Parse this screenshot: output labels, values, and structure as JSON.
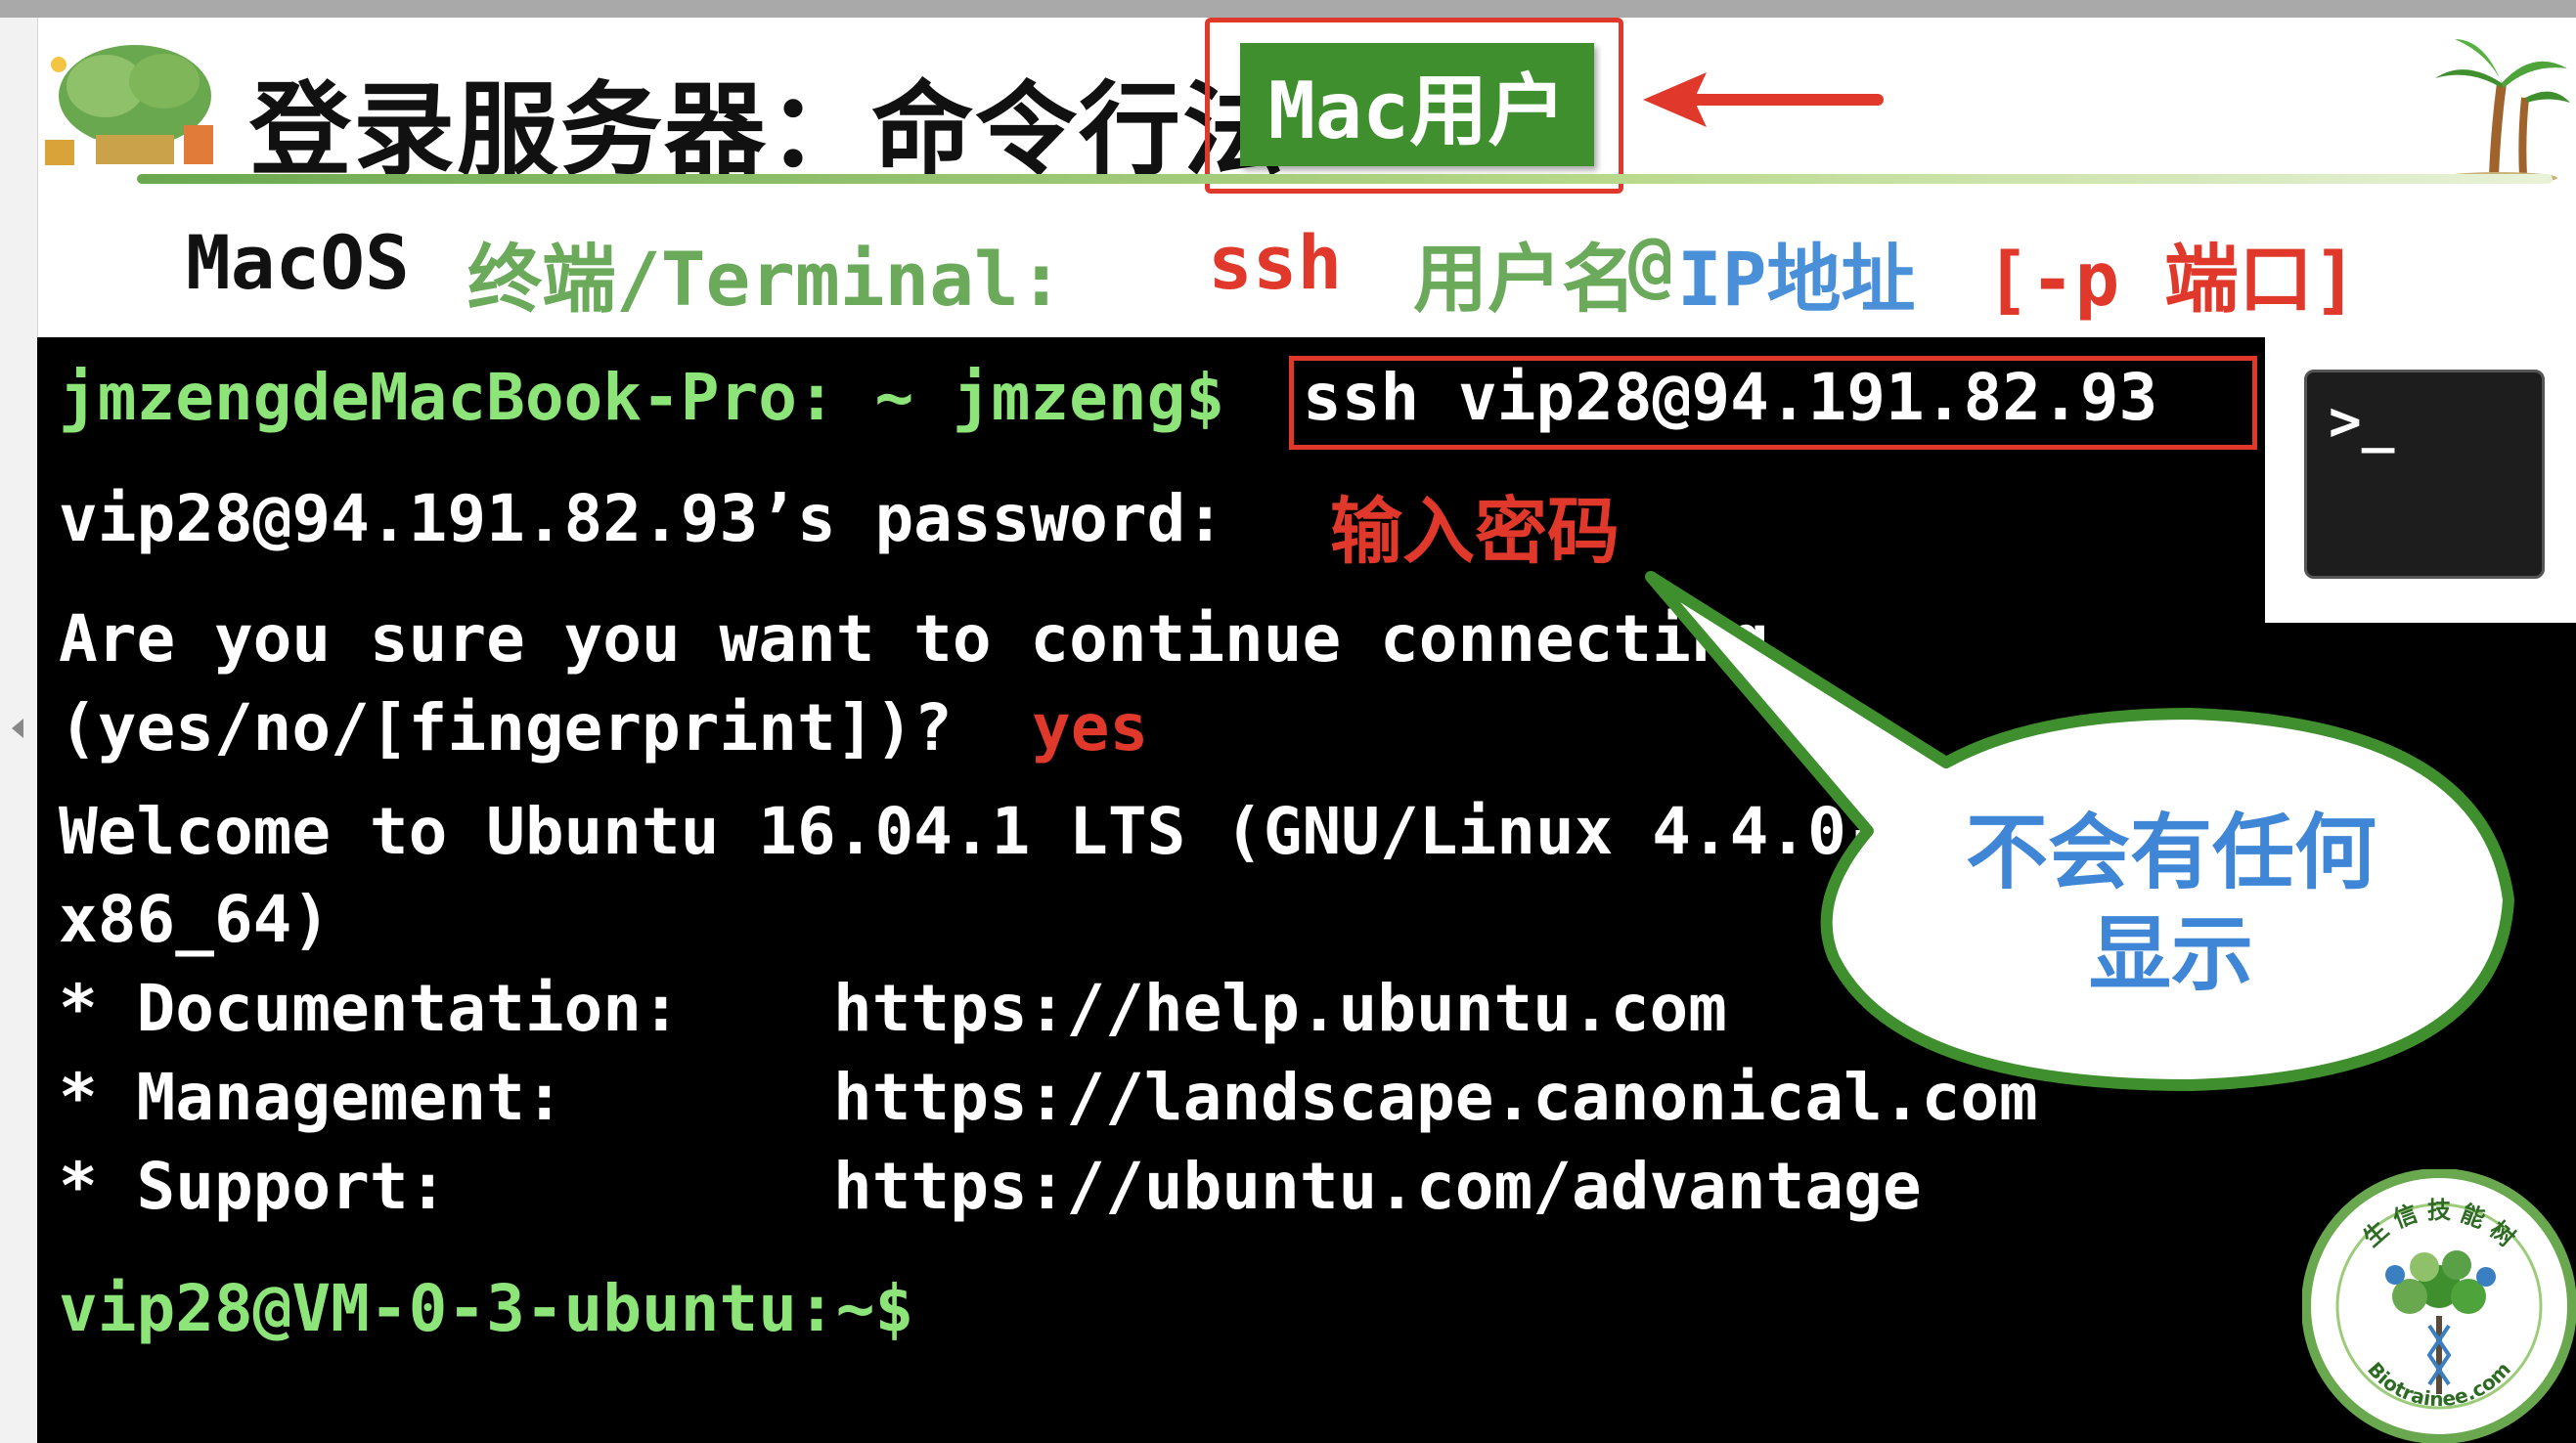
{
  "slide": {
    "title": "登录服务器：命令行法",
    "badge": "Mac用户",
    "subtitle": {
      "os": "MacOS",
      "terminal_label": "终端/Terminal:",
      "ssh": "ssh",
      "username": "用户名",
      "at": "@",
      "ip": "IP地址",
      "port": "[-p 端口]"
    }
  },
  "terminal": {
    "prompt": "jmzengdeMacBook-Pro: ~ jmzeng$",
    "command": "ssh  vip28@94.191.82.93",
    "password_prompt": "vip28@94.191.82.93’s password:",
    "password_note": "输入密码",
    "continue_line1": "Are you sure you want to continue connecting",
    "continue_line2": "(yes/no/[fingerprint])?",
    "continue_answer": "yes",
    "welcome_line1": "Welcome to Ubuntu 16.04.1 LTS (GNU/Linux 4.4.0-",
    "welcome_line2": "x86_64)",
    "doc_label": " * Documentation:",
    "doc_url": "https://help.ubuntu.com",
    "mgmt_label": " * Management:",
    "mgmt_url": "https://landscape.canonical.com",
    "support_label": " * Support:",
    "support_url": "https://ubuntu.com/advantage",
    "final_prompt": "vip28@VM-0-3-ubuntu:~$"
  },
  "terminal_icon": {
    "prompt": ">_"
  },
  "callout": {
    "line1": "不会有任何",
    "line2": "显示"
  },
  "logo": {
    "top_text": "生 信 技 能 树",
    "bottom_text": "Biotrainee.com"
  },
  "colors": {
    "accent_green": "#3f8f2f",
    "terminal_green": "#8de57a",
    "highlight_red": "#e0392b",
    "callout_blue": "#3f86d6"
  }
}
